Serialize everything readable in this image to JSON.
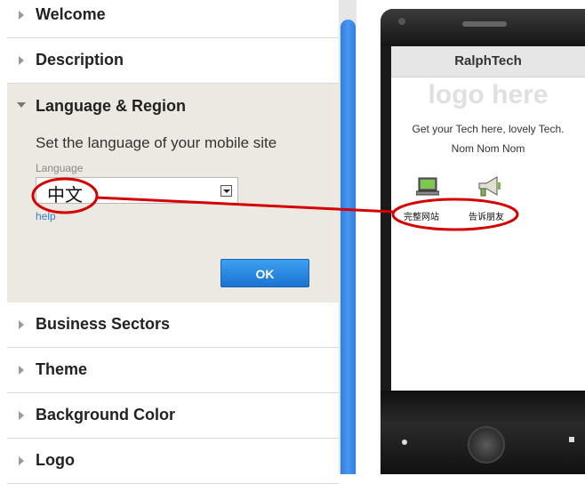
{
  "accordion": {
    "items_above": [
      {
        "label": "Welcome"
      },
      {
        "label": "Description"
      }
    ],
    "expanded": {
      "label": "Language & Region",
      "description": "Set the language of your mobile site",
      "field_label": "Language",
      "language_value": "中文",
      "help_label": "help",
      "ok_label": "OK"
    },
    "items_below": [
      {
        "label": "Business Sectors"
      },
      {
        "label": "Theme"
      },
      {
        "label": "Background Color"
      },
      {
        "label": "Logo"
      }
    ]
  },
  "phone": {
    "header_title": "RalphTech",
    "logo_placeholder": "logo here",
    "tagline": "Get your Tech here, lovely Tech. Nom Nom Nom",
    "icons": [
      {
        "icon": "laptop-icon",
        "label": "完整网站"
      },
      {
        "icon": "megaphone-icon",
        "label": "告诉朋友"
      }
    ]
  },
  "colors": {
    "accent_blue": "#1a73d1",
    "annotation_red": "#d40000",
    "expanded_bg": "#ebe9e1"
  }
}
